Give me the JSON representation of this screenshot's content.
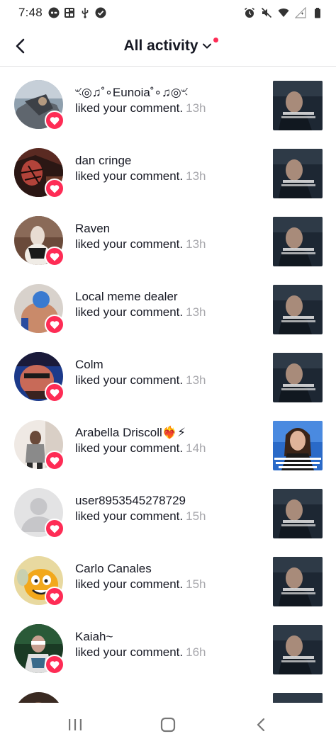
{
  "status_bar": {
    "time": "7:48",
    "left_icons": [
      "gamepad-icon",
      "contacts-icon",
      "usb-icon",
      "check-circle-icon"
    ],
    "right_icons": [
      "alarm-icon",
      "mute-icon",
      "wifi-icon",
      "signal-icon",
      "battery-icon"
    ]
  },
  "header": {
    "title": "All activity",
    "accent_color": "#fe2c55"
  },
  "activity": [
    {
      "username": "ৼ◎♫˚∘Eunoia˚∘♫◎ৼ",
      "action": "liked your comment.",
      "time": "13h",
      "thumb": "man-video"
    },
    {
      "username": "dan cringe",
      "action": "liked your comment.",
      "time": "13h",
      "thumb": "man-video"
    },
    {
      "username": "Raven",
      "action": "liked your comment.",
      "time": "13h",
      "thumb": "man-video"
    },
    {
      "username": "Local meme dealer",
      "action": "liked your comment.",
      "time": "13h",
      "thumb": "man-video"
    },
    {
      "username": "Colm",
      "action": "liked your comment.",
      "time": "13h",
      "thumb": "man-video"
    },
    {
      "username": "Arabella  Driscoll❤️‍🔥⚡",
      "action": "liked your comment.",
      "time": "14h",
      "thumb": "woman-video"
    },
    {
      "username": "user8953545278729",
      "action": "liked your comment.",
      "time": "15h",
      "thumb": "man-video"
    },
    {
      "username": "Carlo Canales",
      "action": "liked your comment.",
      "time": "15h",
      "thumb": "man-video"
    },
    {
      "username": "Kaiah~",
      "action": "liked your comment.",
      "time": "16h",
      "thumb": "man-video"
    },
    {
      "username": "",
      "action": "",
      "time": "",
      "thumb": "man-video"
    }
  ],
  "nav": [
    "recent-apps-icon",
    "home-icon",
    "back-icon"
  ]
}
